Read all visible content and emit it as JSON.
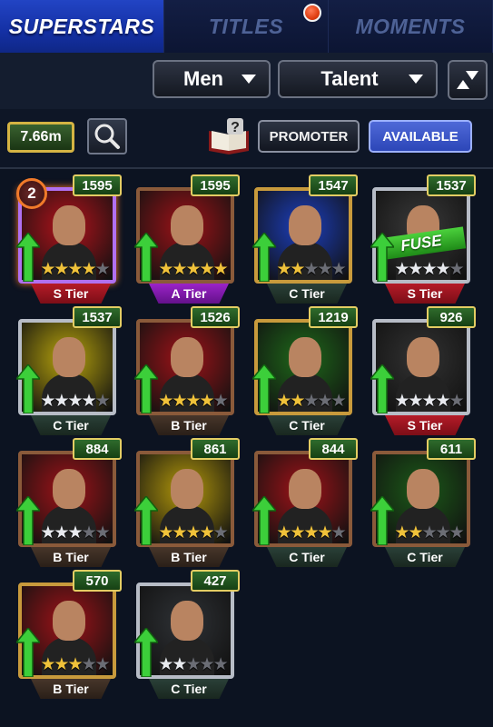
{
  "tabs": [
    {
      "label": "SUPERSTARS",
      "active": true
    },
    {
      "label": "TITLES",
      "active": false
    },
    {
      "label": "MOMENTS",
      "active": false
    }
  ],
  "filters": {
    "gender": "Men",
    "sort_by": "Talent"
  },
  "toolbar": {
    "currency": "7.66m",
    "promoter_label": "PROMOTER",
    "available_label": "AVAILABLE"
  },
  "cards": [
    {
      "score": "1595",
      "tier": "S Tier",
      "stars_filled": 4,
      "star_color": "gold",
      "bg": "#b3121b",
      "frame": "purple",
      "level": "2",
      "fuse": null
    },
    {
      "score": "1595",
      "tier": "A Tier",
      "stars_filled": 5,
      "star_color": "gold",
      "bg": "#a01318",
      "frame": "bronze",
      "level": null,
      "fuse": null
    },
    {
      "score": "1547",
      "tier": "C Tier",
      "stars_filled": 2,
      "star_color": "gold",
      "bg": "#1c3fc0",
      "frame": "gold",
      "level": null,
      "fuse": null
    },
    {
      "score": "1537",
      "tier": "S Tier",
      "stars_filled": 4,
      "star_color": "silver",
      "bg": "#3a3a3a",
      "frame": "silver",
      "level": null,
      "fuse": "FUSE"
    },
    {
      "score": "1537",
      "tier": "C Tier",
      "stars_filled": 4,
      "star_color": "silver",
      "bg": "#b9a50c",
      "frame": "silver",
      "level": null,
      "fuse": null
    },
    {
      "score": "1526",
      "tier": "B Tier",
      "stars_filled": 4,
      "star_color": "gold",
      "bg": "#a01318",
      "frame": "bronze",
      "level": null,
      "fuse": null
    },
    {
      "score": "1219",
      "tier": "C Tier",
      "stars_filled": 2,
      "star_color": "gold",
      "bg": "#1f6a1a",
      "frame": "gold",
      "level": null,
      "fuse": null
    },
    {
      "score": "926",
      "tier": "S Tier",
      "stars_filled": 4,
      "star_color": "silver",
      "bg": "#333333",
      "frame": "silver",
      "level": null,
      "fuse": null
    },
    {
      "score": "884",
      "tier": "B Tier",
      "stars_filled": 3,
      "star_color": "silver",
      "bg": "#a01318",
      "frame": "bronze",
      "level": null,
      "fuse": null
    },
    {
      "score": "861",
      "tier": "B Tier",
      "stars_filled": 4,
      "star_color": "gold",
      "bg": "#b59a0b",
      "frame": "bronze",
      "level": null,
      "fuse": null
    },
    {
      "score": "844",
      "tier": "C Tier",
      "stars_filled": 4,
      "star_color": "gold",
      "bg": "#a01318",
      "frame": "bronze",
      "level": null,
      "fuse": null
    },
    {
      "score": "611",
      "tier": "C Tier",
      "stars_filled": 2,
      "star_color": "gold",
      "bg": "#1c5a18",
      "frame": "bronze",
      "level": null,
      "fuse": null
    },
    {
      "score": "570",
      "tier": "B Tier",
      "stars_filled": 3,
      "star_color": "gold",
      "bg": "#a01318",
      "frame": "gold",
      "level": null,
      "fuse": null
    },
    {
      "score": "427",
      "tier": "C Tier",
      "stars_filled": 2,
      "star_color": "silver",
      "bg": "#2f3236",
      "frame": "silver",
      "level": null,
      "fuse": null
    }
  ]
}
